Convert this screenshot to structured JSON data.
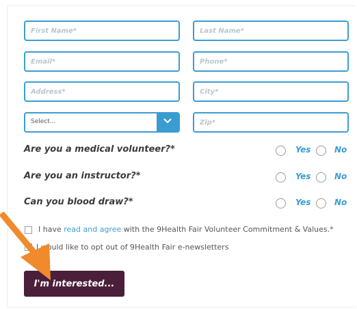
{
  "form": {
    "first_name_placeholder": "First Name*",
    "last_name_placeholder": "Last Name*",
    "email_placeholder": "Email*",
    "phone_placeholder": "Phone*",
    "address_placeholder": "Address*",
    "city_placeholder": "City*",
    "select_value": "Select...",
    "zip_placeholder": "Zip*"
  },
  "questions": [
    {
      "text": "Are you a medical volunteer?*",
      "yes": "Yes",
      "no": "No"
    },
    {
      "text": "Are you an instructor?*",
      "yes": "Yes",
      "no": "No"
    },
    {
      "text": "Can you blood draw?*",
      "yes": "Yes",
      "no": "No"
    }
  ],
  "consent": {
    "prefix": "I have",
    "link": "read and agree",
    "suffix": "with the 9Health Fair Volunteer Commitment & Values.*"
  },
  "optout": {
    "text": "I would like to opt out of 9Health Fair e-newsletters"
  },
  "submit_label": "I'm interested...",
  "colors": {
    "accent": "#3a9dd1",
    "button": "#4b1f3a",
    "arrow": "#f08a2c"
  },
  "icons": {
    "select_chevron": "chevron-down-icon",
    "annotation_arrow": "arrow-icon"
  }
}
